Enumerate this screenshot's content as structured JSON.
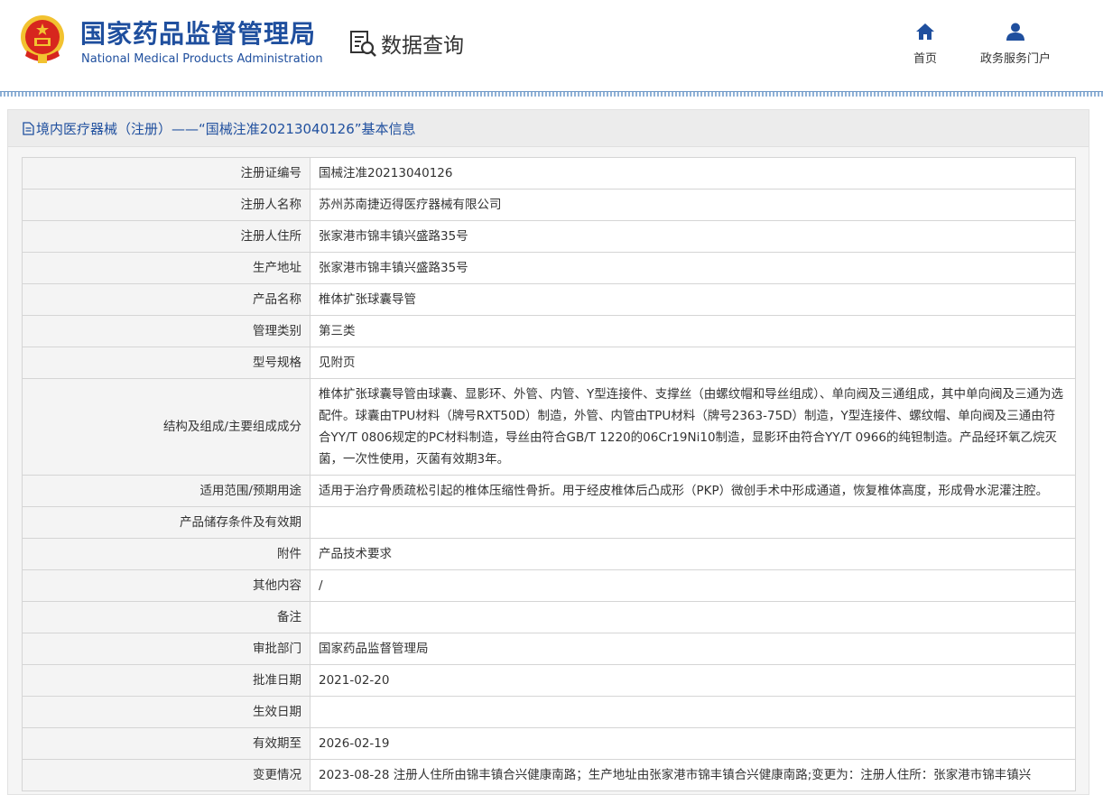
{
  "header": {
    "title_cn": "国家药品监督管理局",
    "title_en": "National Medical Products Administration",
    "section_label": "数据查询",
    "nav": [
      {
        "label": "首页",
        "icon": "home-icon"
      },
      {
        "label": "政务服务门户",
        "icon": "user-icon"
      }
    ]
  },
  "panel": {
    "title": "境内医疗器械（注册）——“国械注准20213040126”基本信息"
  },
  "rows": [
    {
      "label": "注册证编号",
      "value": "国械注准20213040126"
    },
    {
      "label": "注册人名称",
      "value": "苏州苏南捷迈得医疗器械有限公司"
    },
    {
      "label": "注册人住所",
      "value": "张家港市锦丰镇兴盛路35号"
    },
    {
      "label": "生产地址",
      "value": "张家港市锦丰镇兴盛路35号"
    },
    {
      "label": "产品名称",
      "value": "椎体扩张球囊导管"
    },
    {
      "label": "管理类别",
      "value": "第三类"
    },
    {
      "label": "型号规格",
      "value": "见附页"
    },
    {
      "label": "结构及组成/主要组成成分",
      "value": "椎体扩张球囊导管由球囊、显影环、外管、内管、Y型连接件、支撑丝（由螺纹帽和导丝组成）、单向阀及三通组成，其中单向阀及三通为选配件。球囊由TPU材料（牌号RXT50D）制造，外管、内管由TPU材料（牌号2363-75D）制造，Y型连接件、螺纹帽、单向阀及三通由符合YY/T 0806规定的PC材料制造，导丝由符合GB/T 1220的06Cr19Ni10制造，显影环由符合YY/T 0966的纯钽制造。产品经环氧乙烷灭菌，一次性使用，灭菌有效期3年。"
    },
    {
      "label": "适用范围/预期用途",
      "value": "适用于治疗骨质疏松引起的椎体压缩性骨折。用于经皮椎体后凸成形（PKP）微创手术中形成通道，恢复椎体高度，形成骨水泥灌注腔。"
    },
    {
      "label": "产品储存条件及有效期",
      "value": ""
    },
    {
      "label": "附件",
      "value": "产品技术要求"
    },
    {
      "label": "其他内容",
      "value": "/"
    },
    {
      "label": "备注",
      "value": ""
    },
    {
      "label": "审批部门",
      "value": "国家药品监督管理局"
    },
    {
      "label": "批准日期",
      "value": "2021-02-20"
    },
    {
      "label": "生效日期",
      "value": ""
    },
    {
      "label": "有效期至",
      "value": "2026-02-19"
    },
    {
      "label": "变更情况",
      "value": "2023-08-28 注册人住所由锦丰镇合兴健康南路；生产地址由张家港市锦丰镇合兴健康南路;变更为：注册人住所：张家港市锦丰镇兴"
    }
  ],
  "colors": {
    "brand_blue": "#1f4f9e",
    "emblem_red": "#d7261e",
    "emblem_gold": "#f2c230"
  }
}
